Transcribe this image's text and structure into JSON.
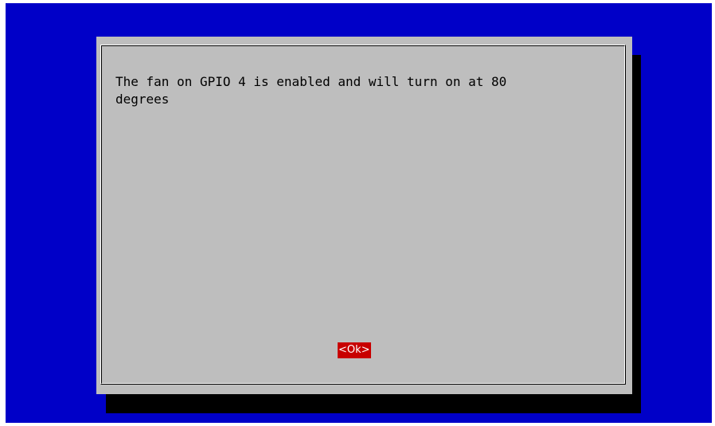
{
  "dialog": {
    "message": "The fan on GPIO 4 is enabled and will turn on at 80\ndegrees",
    "ok_label": "<Ok>"
  },
  "colors": {
    "background": "#0000c8",
    "dialog": "#bebebe",
    "shadow": "#000000",
    "button_active": "#c80000",
    "button_text": "#ffffff"
  }
}
